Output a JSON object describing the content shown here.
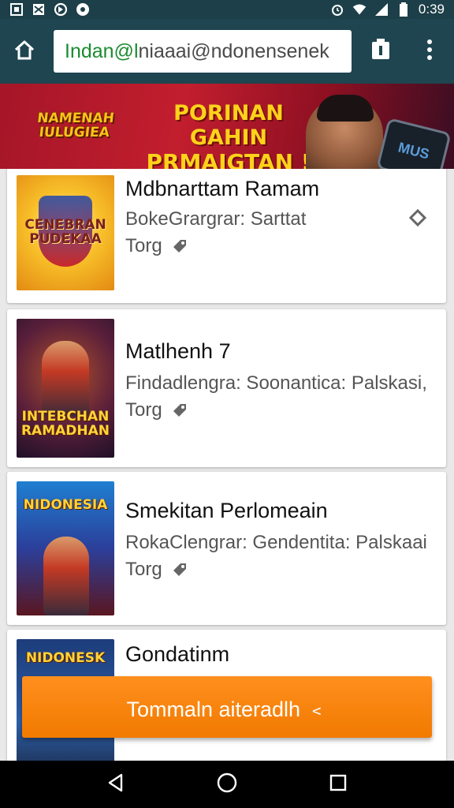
{
  "status_bar": {
    "time": "0:39",
    "left_icons": [
      "image-icon",
      "mail-icon",
      "sync-icon",
      "dot-icon"
    ],
    "right_icons": [
      "alarm-icon",
      "wifi-icon",
      "signal-icon",
      "battery-icon"
    ]
  },
  "toolbar": {
    "url_highlight": "Indan@l",
    "url_rest": "niaaai@ndonensenek",
    "home_icon": "home-icon",
    "tabs_icon": "tabs-icon",
    "menu_icon": "menu-icon"
  },
  "banner": {
    "logo_text": "NAMENAH IULUGIEA",
    "headline_1": "PORINAN GAHIN",
    "headline_2": "PRMAIGTAN !",
    "phone_text": "MUS"
  },
  "items": [
    {
      "title": "Mdbnarttam Ramam",
      "meta": "BokeGrargrar: Sarttat",
      "sub": "Torg",
      "thumb_text": "CENEBRAN PUDEKAA",
      "action_icon": "diamond-icon"
    },
    {
      "title": "Matlhenh 7",
      "meta": "Findadlengra: Soonantica: Palskasi,",
      "sub": "Torg",
      "thumb_text": "INTEBCHAN RAMADHAN"
    },
    {
      "title": "Smekitan Perlomeain",
      "meta": "RokaClengrar: Gendentita: Palskaai",
      "sub": "Torg",
      "thumb_text": "NIDONESIA"
    },
    {
      "title": "Gondatinm",
      "meta": "",
      "sub": "",
      "thumb_text": "NIDONESK"
    }
  ],
  "fab_label": "Tommaln aiteradlh ﹤",
  "colors": {
    "toolbar": "#1e4550",
    "accent_orange": "#f38400",
    "banner_red": "#c21e2e",
    "url_green": "#1a8c2e"
  }
}
